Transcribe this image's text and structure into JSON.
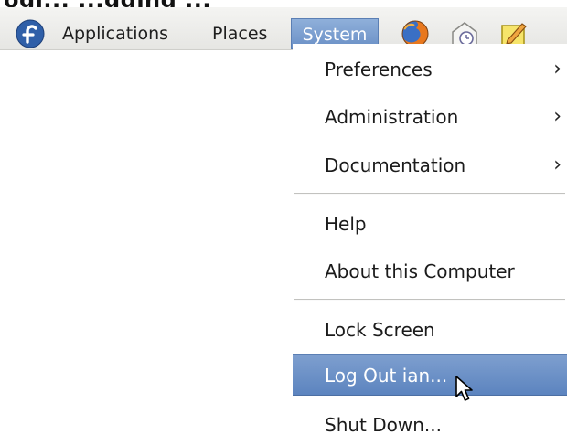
{
  "top_caption": "ogi... ...gging ...",
  "panel": {
    "menus": {
      "applications": "Applications",
      "places": "Places",
      "system": "System"
    },
    "icons": {
      "distro": "fedora-logo-icon",
      "browser": "firefox-icon",
      "clock": "clock-icon",
      "notes": "notes-icon"
    }
  },
  "system_menu": {
    "items": [
      {
        "label": "Preferences",
        "submenu": true
      },
      {
        "label": "Administration",
        "submenu": true
      },
      {
        "label": "Documentation",
        "submenu": true
      },
      {
        "label": "Help",
        "submenu": false
      },
      {
        "label": "About this Computer",
        "submenu": false
      },
      {
        "label": "Lock Screen",
        "submenu": false
      },
      {
        "label": "Log Out ian...",
        "submenu": false,
        "highlighted": true
      },
      {
        "label": "Shut Down...",
        "submenu": false
      }
    ],
    "submenu_arrow": "›"
  },
  "colors": {
    "highlight": "#6a90c6",
    "panel": "#eeeeec"
  }
}
